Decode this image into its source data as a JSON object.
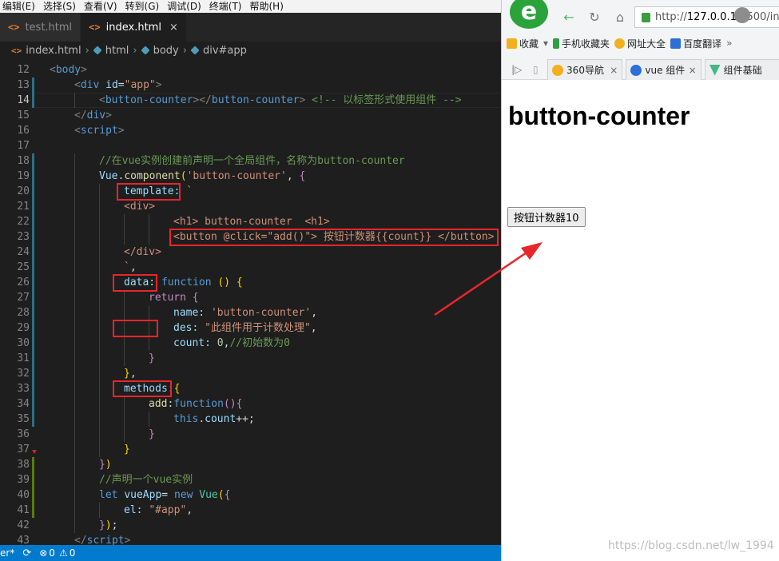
{
  "menubar": {
    "items": [
      "编辑(E)",
      "选择(S)",
      "查看(V)",
      "转到(G)",
      "调试(D)",
      "终端(T)",
      "帮助(H)"
    ]
  },
  "tabs": [
    {
      "icon": "<>",
      "label": "test.html",
      "active": false
    },
    {
      "icon": "<>",
      "label": "index.html",
      "active": true,
      "close": "×"
    }
  ],
  "breadcrumb": [
    "index.html",
    "html",
    "body",
    "div#app"
  ],
  "editor": {
    "active_line": 14,
    "lines": [
      {
        "n": 12,
        "indent": 0,
        "tokens": [
          [
            "p",
            "<"
          ],
          [
            "tag",
            "body"
          ],
          [
            "p",
            ">"
          ]
        ]
      },
      {
        "n": 13,
        "indent": 1,
        "tokens": [
          [
            "p",
            "<"
          ],
          [
            "tag",
            "div"
          ],
          [
            "def",
            " "
          ],
          [
            "attr",
            "id"
          ],
          [
            "def",
            "="
          ],
          [
            "str",
            "\"app\""
          ],
          [
            "p",
            ">"
          ]
        ]
      },
      {
        "n": 14,
        "indent": 2,
        "tokens": [
          [
            "p",
            "<"
          ],
          [
            "tag",
            "button-counter"
          ],
          [
            "p",
            "></"
          ],
          [
            "tag",
            "button-counter"
          ],
          [
            "p",
            ">"
          ],
          [
            "def",
            " "
          ],
          [
            "cmt",
            "<!-- 以标签形式使用组件 -->"
          ]
        ]
      },
      {
        "n": 15,
        "indent": 1,
        "tokens": [
          [
            "p",
            "</"
          ],
          [
            "tag",
            "div"
          ],
          [
            "p",
            ">"
          ]
        ]
      },
      {
        "n": 16,
        "indent": 1,
        "tokens": [
          [
            "p",
            "<"
          ],
          [
            "tag",
            "script"
          ],
          [
            "p",
            ">"
          ]
        ]
      },
      {
        "n": 17,
        "indent": 0,
        "tokens": []
      },
      {
        "n": 18,
        "indent": 2,
        "tokens": [
          [
            "cmt",
            "//在vue实例创建前声明一个全局组件，名称为button-counter"
          ]
        ]
      },
      {
        "n": 19,
        "indent": 2,
        "tokens": [
          [
            "prop",
            "Vue"
          ],
          [
            "def",
            "."
          ],
          [
            "fn",
            "component"
          ],
          [
            "brk",
            "("
          ],
          [
            "str",
            "'button-counter'"
          ],
          [
            "def",
            ", "
          ],
          [
            "kw2",
            "{"
          ]
        ]
      },
      {
        "n": 20,
        "indent": 3,
        "tokens": [
          [
            "prop",
            "template:"
          ],
          [
            "def",
            " "
          ],
          [
            "str",
            "`"
          ]
        ]
      },
      {
        "n": 21,
        "indent": 3,
        "tokens": [
          [
            "str",
            "<div>"
          ]
        ]
      },
      {
        "n": 22,
        "indent": 5,
        "tokens": [
          [
            "str",
            "<h1> button-counter  <h1>"
          ]
        ]
      },
      {
        "n": 23,
        "indent": 5,
        "tokens": [
          [
            "str",
            "<button @click=\"add()\"> 按钮计数器{{count}} </button>"
          ]
        ]
      },
      {
        "n": 24,
        "indent": 3,
        "tokens": [
          [
            "str",
            "</div>"
          ]
        ]
      },
      {
        "n": 25,
        "indent": 3,
        "tokens": [
          [
            "str",
            "`"
          ],
          [
            "def",
            ","
          ]
        ]
      },
      {
        "n": 26,
        "indent": 3,
        "tokens": [
          [
            "prop",
            "data:"
          ],
          [
            "def",
            " "
          ],
          [
            "kw",
            "function"
          ],
          [
            "def",
            " "
          ],
          [
            "brk",
            "()"
          ],
          [
            "def",
            " "
          ],
          [
            "brk",
            "{"
          ]
        ]
      },
      {
        "n": 27,
        "indent": 4,
        "tokens": [
          [
            "kw2",
            "return"
          ],
          [
            "def",
            " "
          ],
          [
            "kw2",
            "{"
          ]
        ]
      },
      {
        "n": 28,
        "indent": 5,
        "tokens": [
          [
            "prop",
            "name:"
          ],
          [
            "def",
            " "
          ],
          [
            "str",
            "'button-counter'"
          ],
          [
            "def",
            ","
          ]
        ]
      },
      {
        "n": 29,
        "indent": 5,
        "tokens": [
          [
            "prop",
            "des:"
          ],
          [
            "def",
            " "
          ],
          [
            "str",
            "\"此组件用于计数处理\""
          ],
          [
            "def",
            ","
          ]
        ]
      },
      {
        "n": 30,
        "indent": 5,
        "tokens": [
          [
            "prop",
            "count:"
          ],
          [
            "def",
            " "
          ],
          [
            "num",
            "0"
          ],
          [
            "def",
            ","
          ],
          [
            "cmt",
            "//初始数为0"
          ]
        ]
      },
      {
        "n": 31,
        "indent": 4,
        "tokens": [
          [
            "kw2",
            "}"
          ]
        ]
      },
      {
        "n": 32,
        "indent": 3,
        "tokens": [
          [
            "brk",
            "}"
          ],
          [
            "def",
            ","
          ]
        ]
      },
      {
        "n": 33,
        "indent": 3,
        "tokens": [
          [
            "prop",
            "methods:"
          ],
          [
            "brk",
            "{"
          ]
        ]
      },
      {
        "n": 34,
        "indent": 4,
        "tokens": [
          [
            "fn",
            "add"
          ],
          [
            "def",
            ":"
          ],
          [
            "kw",
            "function"
          ],
          [
            "kw2",
            "()"
          ],
          [
            "kw2",
            "{"
          ]
        ]
      },
      {
        "n": 35,
        "indent": 5,
        "tokens": [
          [
            "kw",
            "this"
          ],
          [
            "def",
            "."
          ],
          [
            "prop",
            "count"
          ],
          [
            "def",
            "++;"
          ]
        ]
      },
      {
        "n": 36,
        "indent": 4,
        "tokens": [
          [
            "kw2",
            "}"
          ]
        ]
      },
      {
        "n": 37,
        "indent": 3,
        "tokens": [
          [
            "brk",
            "}"
          ]
        ]
      },
      {
        "n": 38,
        "indent": 2,
        "tokens": [
          [
            "kw2",
            "}"
          ],
          [
            "brk",
            ")"
          ]
        ]
      },
      {
        "n": 39,
        "indent": 2,
        "tokens": [
          [
            "cmt",
            "//声明一个vue实例"
          ]
        ]
      },
      {
        "n": 40,
        "indent": 2,
        "tokens": [
          [
            "kw",
            "let"
          ],
          [
            "def",
            " "
          ],
          [
            "prop",
            "vueApp"
          ],
          [
            "def",
            "= "
          ],
          [
            "kw",
            "new"
          ],
          [
            "def",
            " "
          ],
          [
            "cls",
            "Vue"
          ],
          [
            "brk",
            "("
          ],
          [
            "kw2",
            "{"
          ]
        ]
      },
      {
        "n": 41,
        "indent": 3,
        "tokens": [
          [
            "prop",
            "el:"
          ],
          [
            "def",
            " "
          ],
          [
            "str",
            "\"#app\""
          ],
          [
            "def",
            ","
          ]
        ]
      },
      {
        "n": 42,
        "indent": 2,
        "tokens": [
          [
            "kw2",
            "}"
          ],
          [
            "brk",
            ")"
          ],
          [
            "def",
            ";"
          ]
        ]
      },
      {
        "n": 43,
        "indent": 1,
        "tokens": [
          [
            "p",
            "</"
          ],
          [
            "tag",
            "script"
          ],
          [
            "p",
            ">"
          ]
        ]
      }
    ]
  },
  "statusbar": {
    "branch": "er*",
    "sync_icon": "sync-icon",
    "errors": "0",
    "warnings": "0"
  },
  "browser": {
    "url_prefix": "http://",
    "url_host": "127.0.0.1",
    "url_rest": ":5500/in",
    "favorites": [
      {
        "label": "收藏",
        "icon": "star-icon",
        "color": "#f2b01e"
      },
      {
        "label": "手机收藏夹",
        "icon": "phone-icon",
        "color": "#2f9f3f"
      },
      {
        "label": "网址大全",
        "icon": "navigation-icon",
        "color": "#f2b01e"
      },
      {
        "label": "百度翻译",
        "icon": "baidu-icon",
        "color": "#2d6fd6"
      }
    ],
    "more_favorites": "»",
    "tabs": [
      {
        "label": "360导航",
        "icon_color": "#f2b01e",
        "close": "×"
      },
      {
        "label": "vue 组件",
        "icon_color": "#2d6fd6",
        "close": "×"
      },
      {
        "label": "组件基础",
        "icon_color": "#41b883",
        "close": ""
      }
    ],
    "page_heading": "button-counter",
    "page_button": "按钮计数器10"
  },
  "watermark": "https://blog.csdn.net/lw_1994",
  "colors": {
    "annotation_red": "#e8262a",
    "accent_blue": "#007acc"
  }
}
